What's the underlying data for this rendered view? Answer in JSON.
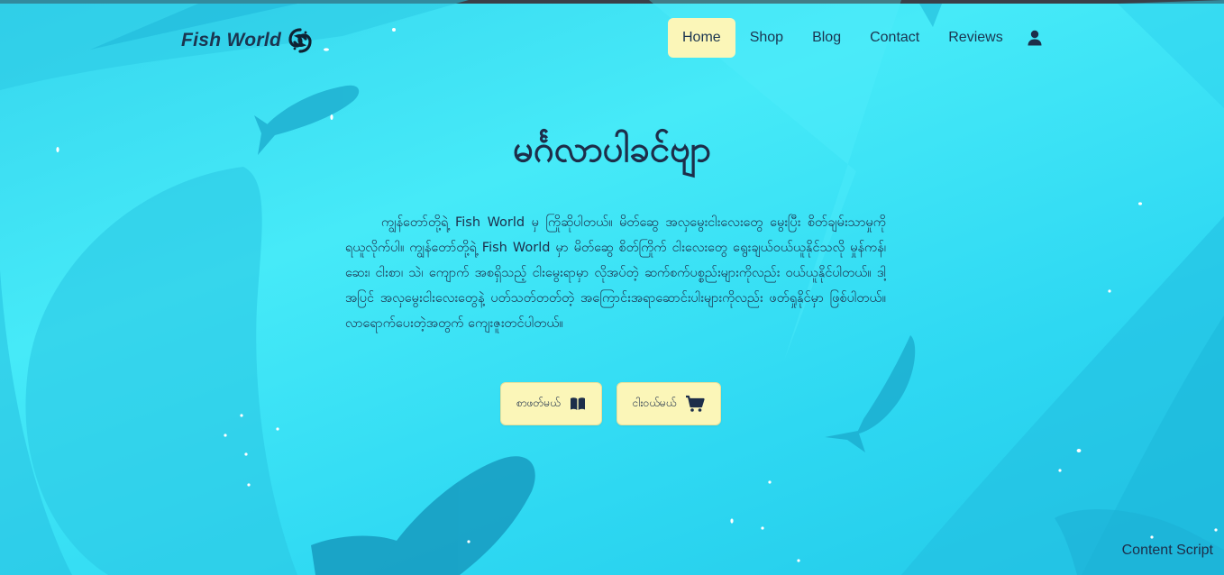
{
  "brand": {
    "name": "Fish  World",
    "logo_icon": "koi-yin-yang-icon"
  },
  "nav": {
    "items": [
      {
        "label": "Home",
        "active": true
      },
      {
        "label": "Shop",
        "active": false
      },
      {
        "label": "Blog",
        "active": false
      },
      {
        "label": "Contact",
        "active": false
      },
      {
        "label": "Reviews",
        "active": false
      }
    ],
    "user_icon": "user-icon"
  },
  "hero": {
    "title": "မင်္ဂလာပါခင်ဗျာ",
    "body": "ကျွန်တော်တို့ရဲ့ Fish World မှ ကြိုဆိုပါတယ်။ မိတ်ဆွေ အလှမွေးငါးလေးတွေ မွေးပြီး စိတ်ချမ်းသာမှုကို ရယူလိုက်ပါ။ ကျွန်တော်တို့ရဲ့ Fish World မှာ မိတ်ဆွေ စိတ်ကြိုက် ငါးလေးတွေ ရွေးချယ်ဝယ်ယူနိုင်သလို မှုန်ကန်၊ ဆေး၊ ငါးစာ၊ သဲ၊ ကျောက် အစရှိသည့် ငါးမွေးရာမှာ လိုအပ်တဲ့ ဆက်စက်ပစ္စည်းများကိုလည်း ဝယ်ယူနိုင်ပါတယ်။ ဒါ့အပြင် အလှမွေးငါးလေးတွေနဲ့ ပတ်သတ်တတ်တဲ့ အကြောင်းအရာဆောင်းပါးများကိုလည်း ဖတ်ရှုနိုင်မှာ ဖြစ်ပါတယ်။ လာရောက်ပေးတဲ့အတွက် ကျေးဇူးတင်ပါတယ်။",
    "buttons": [
      {
        "label": "စာဖတ်မယ်",
        "icon": "book-icon"
      },
      {
        "label": "ငါးဝယ်မယ်",
        "icon": "cart-icon"
      }
    ]
  },
  "footer": {
    "content_script": "Content Script"
  },
  "colors": {
    "background": "#36d6ee",
    "accent": "#fbf6b8",
    "text": "#1d2e4a",
    "top_border": "#3a3f48"
  }
}
